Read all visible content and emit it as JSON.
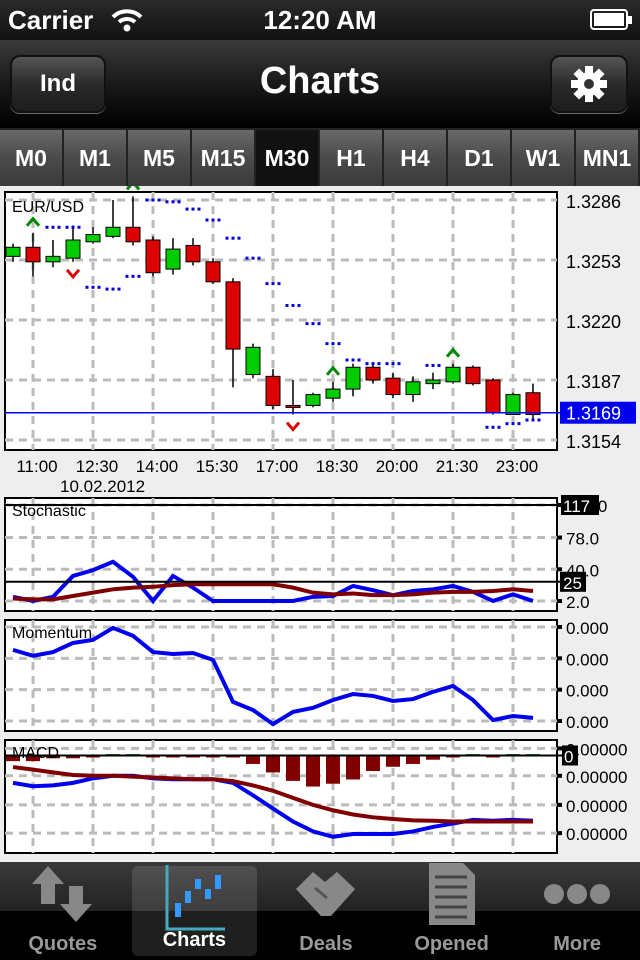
{
  "status": {
    "carrier": "Carrier",
    "time": "12:20 AM"
  },
  "nav": {
    "left_button": "Ind",
    "title": "Charts",
    "settings_icon": "gear-icon"
  },
  "timeframes": [
    "M0",
    "M1",
    "M5",
    "M15",
    "M30",
    "H1",
    "H4",
    "D1",
    "W1",
    "MN1"
  ],
  "selected_timeframe": "M30",
  "tabbar": [
    {
      "label": "Quotes",
      "icon": "quotes-arrows-icon"
    },
    {
      "label": "Charts",
      "icon": "candlestick-chart-icon",
      "selected": true
    },
    {
      "label": "Deals",
      "icon": "handshake-icon"
    },
    {
      "label": "Opened",
      "icon": "document-icon"
    },
    {
      "label": "More",
      "icon": "more-dots-icon"
    }
  ],
  "chart_data": [
    {
      "type": "candlestick",
      "title": "EUR/USD",
      "ylim": [
        1.3154,
        1.3286
      ],
      "y_ticks": [
        "1.3286",
        "1.3253",
        "1.3220",
        "1.3187",
        "1.3154"
      ],
      "current_price": "1.3169",
      "x_tick_labels": [
        "11:00",
        "12:30",
        "14:00",
        "15:30",
        "17:00",
        "18:30",
        "20:00",
        "21:30",
        "23:00"
      ],
      "date_label": "10.02.2012",
      "grid": true,
      "colors": {
        "up": "#00cc00",
        "down": "#dd0000",
        "sar": "#0000dd",
        "current_line": "#0000ff"
      },
      "candles": [
        [
          1.3255,
          1.326,
          1.3262,
          1.3252
        ],
        [
          1.326,
          1.3252,
          1.3268,
          1.3244
        ],
        [
          1.3252,
          1.3255,
          1.3264,
          1.3249
        ],
        [
          1.3254,
          1.3264,
          1.3272,
          1.3252
        ],
        [
          1.3263,
          1.3267,
          1.3271,
          1.3262
        ],
        [
          1.3266,
          1.3271,
          1.3286,
          1.3265
        ],
        [
          1.3271,
          1.3263,
          1.3288,
          1.3261
        ],
        [
          1.3264,
          1.3246,
          1.3266,
          1.3244
        ],
        [
          1.3248,
          1.3259,
          1.3265,
          1.3245
        ],
        [
          1.3261,
          1.3252,
          1.3265,
          1.325
        ],
        [
          1.3252,
          1.3241,
          1.3254,
          1.324
        ],
        [
          1.3241,
          1.3204,
          1.3243,
          1.3183
        ],
        [
          1.319,
          1.3205,
          1.3207,
          1.3188
        ],
        [
          1.3189,
          1.3173,
          1.3193,
          1.3171
        ],
        [
          1.3173,
          1.3172,
          1.3187,
          1.3168
        ],
        [
          1.3173,
          1.3179,
          1.318,
          1.3172
        ],
        [
          1.3177,
          1.3182,
          1.3186,
          1.3175
        ],
        [
          1.3182,
          1.3194,
          1.3196,
          1.3178
        ],
        [
          1.3194,
          1.3187,
          1.3196,
          1.3185
        ],
        [
          1.3188,
          1.3179,
          1.3191,
          1.3177
        ],
        [
          1.3179,
          1.3186,
          1.3189,
          1.3175
        ],
        [
          1.3185,
          1.3187,
          1.3191,
          1.3182
        ],
        [
          1.3186,
          1.3194,
          1.3196,
          1.3185
        ],
        [
          1.3194,
          1.3185,
          1.3195,
          1.3184
        ],
        [
          1.3187,
          1.3169,
          1.3188,
          1.3168
        ],
        [
          1.3168,
          1.3179,
          1.318,
          1.3168
        ],
        [
          1.318,
          1.3168,
          1.3185,
          1.3165
        ]
      ],
      "sar": [
        null,
        null,
        1.3271,
        1.3271,
        1.3238,
        1.3237,
        1.3244,
        1.3286,
        1.3285,
        1.3281,
        1.3275,
        1.3265,
        1.3254,
        1.324,
        1.3228,
        1.3218,
        1.3207,
        1.3198,
        1.3196,
        1.3196,
        null,
        1.3195,
        null,
        null,
        1.3161,
        1.3163,
        1.3165
      ],
      "fractals_up": [
        1,
        6,
        16,
        22
      ],
      "fractals_down": [
        3,
        14
      ]
    },
    {
      "type": "line",
      "title": "Stochastic",
      "ylim": [
        2,
        117
      ],
      "y_ticks": [
        "117.0",
        "78.0",
        "40.0",
        "2.0"
      ],
      "y_tick_values": [
        117,
        78,
        40,
        2
      ],
      "level": "25",
      "level_value": 25,
      "highlight_max": "117",
      "series": [
        {
          "color": "#0000ee",
          "values": [
            7,
            2,
            7,
            32,
            39,
            49,
            31,
            2,
            32,
            18,
            2,
            2,
            2,
            2,
            2,
            7,
            8,
            20,
            15,
            9,
            14,
            16,
            20,
            13,
            2,
            10,
            2
          ]
        },
        {
          "color": "#800000",
          "values": [
            5,
            4,
            4,
            8,
            12,
            16,
            18,
            19,
            21,
            22,
            22,
            22,
            22,
            22,
            18,
            12,
            10,
            11,
            9,
            9,
            10,
            12,
            13,
            13,
            14,
            16,
            14
          ]
        }
      ]
    },
    {
      "type": "line",
      "title": "Momentum",
      "ylim": [
        0,
        3
      ],
      "y_ticks": [
        "0.000",
        "0.000",
        "0.000",
        "0.000"
      ],
      "y_tick_values": [
        3,
        2,
        1,
        0
      ],
      "series": [
        {
          "color": "#0000ee",
          "values": [
            2.27,
            2.08,
            2.2,
            2.49,
            2.59,
            2.97,
            2.72,
            2.2,
            2.14,
            2.17,
            1.95,
            0.61,
            0.35,
            -0.1,
            0.29,
            0.42,
            0.67,
            0.86,
            0.8,
            0.64,
            0.7,
            0.93,
            1.12,
            0.67,
            0.03,
            0.16,
            0.1
          ]
        }
      ]
    },
    {
      "type": "bar+line",
      "title": "MACD",
      "ylim": [
        -3.1,
        0.3
      ],
      "y_ticks": [
        "0.00000",
        "0.00000",
        "0.00000",
        "0.00000"
      ],
      "y_tick_values": [
        0.25,
        -0.72,
        -1.75,
        -2.75
      ],
      "zero_label": "0",
      "histogram": [
        -0.2,
        -0.2,
        -0.1,
        -0.1,
        -0.05,
        0.05,
        0.05,
        0,
        0,
        0,
        0,
        -0.05,
        -0.3,
        -0.6,
        -0.9,
        -1.1,
        -1.0,
        -0.85,
        -0.55,
        -0.4,
        -0.3,
        -0.15,
        -0.05,
        0.05,
        0,
        0.05,
        0.05
      ],
      "series": [
        {
          "color": "#0000ee",
          "values": [
            -0.97,
            -1.09,
            -1.06,
            -0.97,
            -0.81,
            -0.72,
            -0.72,
            -0.81,
            -0.84,
            -0.84,
            -0.84,
            -0.97,
            -1.41,
            -1.88,
            -2.34,
            -2.69,
            -2.88,
            -2.78,
            -2.78,
            -2.78,
            -2.69,
            -2.53,
            -2.41,
            -2.28,
            -2.31,
            -2.28,
            -2.31
          ]
        },
        {
          "color": "#800000",
          "values": [
            -0.41,
            -0.5,
            -0.6,
            -0.69,
            -0.72,
            -0.72,
            -0.75,
            -0.78,
            -0.81,
            -0.84,
            -0.84,
            -0.91,
            -1.06,
            -1.25,
            -1.5,
            -1.75,
            -1.94,
            -2.09,
            -2.19,
            -2.25,
            -2.3,
            -2.31,
            -2.34,
            -2.34,
            -2.34,
            -2.34,
            -2.34
          ]
        }
      ]
    }
  ]
}
